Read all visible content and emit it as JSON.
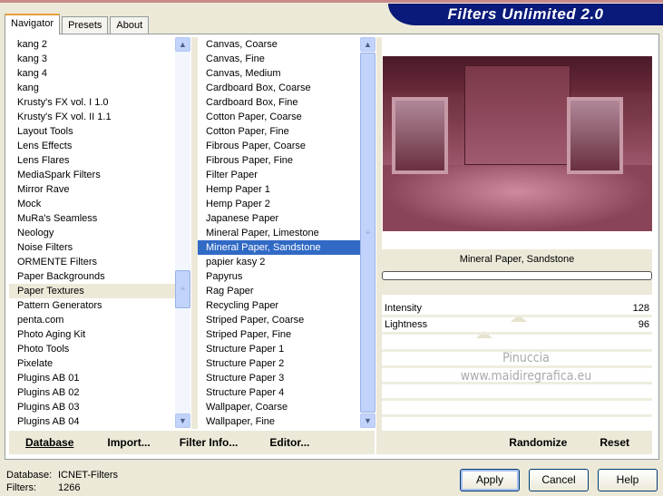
{
  "title": "Filters Unlimited 2.0",
  "tabs": [
    "Navigator",
    "Presets",
    "About"
  ],
  "categories": [
    "kang 2",
    "kang 3",
    "kang 4",
    "kang",
    "Krusty's FX vol. I 1.0",
    "Krusty's FX vol. II 1.1",
    "Layout Tools",
    "Lens Effects",
    "Lens Flares",
    "MediaSpark Filters",
    "Mirror Rave",
    "Mock",
    "MuRa's Seamless",
    "Neology",
    "Noise Filters",
    "ORMENTE Filters",
    "Paper Backgrounds",
    "Paper Textures",
    "Pattern Generators",
    "penta.com",
    "Photo Aging Kit",
    "Photo Tools",
    "Pixelate",
    "Plugins AB 01",
    "Plugins AB 02",
    "Plugins AB 03",
    "Plugins AB 04"
  ],
  "selected_category": "Paper Textures",
  "filters": [
    "Canvas, Coarse",
    "Canvas, Fine",
    "Canvas, Medium",
    "Cardboard Box, Coarse",
    "Cardboard Box, Fine",
    "Cotton Paper, Coarse",
    "Cotton Paper, Fine",
    "Fibrous Paper, Coarse",
    "Fibrous Paper, Fine",
    "Filter Paper",
    "Hemp Paper 1",
    "Hemp Paper 2",
    "Japanese Paper",
    "Mineral Paper, Limestone",
    "Mineral Paper, Sandstone",
    "papier kasy 2",
    "Papyrus",
    "Rag Paper",
    "Recycling Paper",
    "Striped Paper, Coarse",
    "Striped Paper, Fine",
    "Structure Paper 1",
    "Structure Paper 2",
    "Structure Paper 3",
    "Structure Paper 4",
    "Wallpaper, Coarse",
    "Wallpaper, Fine"
  ],
  "selected_filter": "Mineral Paper, Sandstone",
  "filter_name": "Mineral Paper, Sandstone",
  "params": [
    {
      "label": "Intensity",
      "value": "128",
      "fraction": 0.5
    },
    {
      "label": "Lightness",
      "value": "96",
      "fraction": 0.375
    }
  ],
  "watermark": [
    "Pinuccia",
    "www.maidiregrafica.eu"
  ],
  "bottom_left": [
    "Database",
    "Import...",
    "Filter Info...",
    "Editor..."
  ],
  "bottom_right": [
    "Randomize",
    "Reset"
  ],
  "status": {
    "db_label": "Database:",
    "db_value": "ICNET-Filters",
    "filters_label": "Filters:",
    "filters_value": "1266"
  },
  "buttons": {
    "apply": "Apply",
    "cancel": "Cancel",
    "help": "Help"
  }
}
